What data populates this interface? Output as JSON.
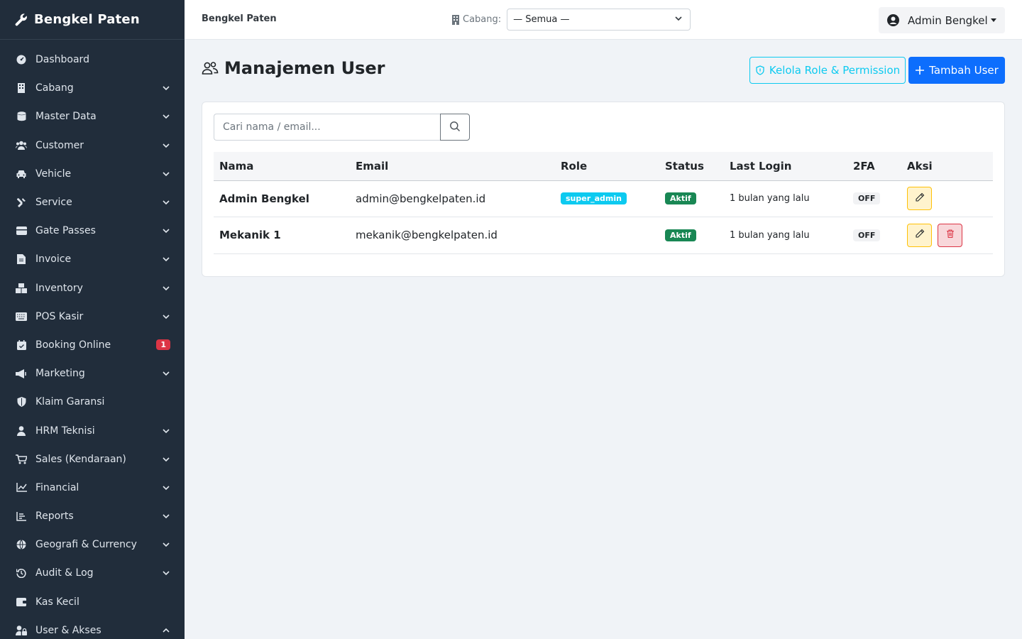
{
  "brand": {
    "name": "Bengkel Paten",
    "icon": "wrench-icon"
  },
  "sidebar": {
    "items": [
      {
        "label": "Dashboard",
        "icon": "dashboard-icon",
        "chevron": false
      },
      {
        "label": "Cabang",
        "icon": "building-icon",
        "chevron": "down"
      },
      {
        "label": "Master Data",
        "icon": "database-icon",
        "chevron": "down"
      },
      {
        "label": "Customer",
        "icon": "users-icon",
        "chevron": "down"
      },
      {
        "label": "Vehicle",
        "icon": "car-icon",
        "chevron": "down"
      },
      {
        "label": "Service",
        "icon": "tools-icon",
        "chevron": "down"
      },
      {
        "label": "Gate Passes",
        "icon": "ticket-icon",
        "chevron": "down"
      },
      {
        "label": "Invoice",
        "icon": "invoice-icon",
        "chevron": "down"
      },
      {
        "label": "Inventory",
        "icon": "boxes-icon",
        "chevron": "down"
      },
      {
        "label": "POS Kasir",
        "icon": "keyboard-icon",
        "chevron": "down"
      },
      {
        "label": "Booking Online",
        "icon": "calendar-icon",
        "chevron": false,
        "badge": "1"
      },
      {
        "label": "Marketing",
        "icon": "megaphone-icon",
        "chevron": "down"
      },
      {
        "label": "Klaim Garansi",
        "icon": "shield-icon",
        "chevron": false
      },
      {
        "label": "HRM Teknisi",
        "icon": "user-tie-icon",
        "chevron": "down"
      },
      {
        "label": "Sales (Kendaraan)",
        "icon": "cart-icon",
        "chevron": "down"
      },
      {
        "label": "Financial",
        "icon": "chart-line-icon",
        "chevron": "down"
      },
      {
        "label": "Reports",
        "icon": "bar-chart-icon",
        "chevron": "down"
      },
      {
        "label": "Geografi & Currency",
        "icon": "globe-icon",
        "chevron": "down"
      },
      {
        "label": "Audit & Log",
        "icon": "history-icon",
        "chevron": "down"
      },
      {
        "label": "Kas Kecil",
        "icon": "wallet-icon",
        "chevron": false
      },
      {
        "label": "User & Akses",
        "icon": "user-lock-icon",
        "chevron": "up"
      }
    ]
  },
  "topbar": {
    "title": "Bengkel Paten",
    "branch_label": "Cabang:",
    "branch_value": "— Semua —",
    "user_name": "Admin Bengkel"
  },
  "page": {
    "title": "Manajemen User",
    "role_button": "Kelola Role & Permission",
    "add_button": "Tambah User"
  },
  "search": {
    "placeholder": "Cari nama / email..."
  },
  "table": {
    "columns": [
      "Nama",
      "Email",
      "Role",
      "Status",
      "Last Login",
      "2FA",
      "Aksi"
    ],
    "rows": [
      {
        "name": "Admin Bengkel",
        "email": "admin@bengkelpaten.id",
        "role": "super_admin",
        "status": "Aktif",
        "last_login": "1 bulan yang lalu",
        "twofa": "OFF",
        "can_delete": false
      },
      {
        "name": "Mekanik 1",
        "email": "mekanik@bengkelpaten.id",
        "role": "",
        "status": "Aktif",
        "last_login": "1 bulan yang lalu",
        "twofa": "OFF",
        "can_delete": true
      }
    ]
  },
  "colors": {
    "sidebar": "#212d3b",
    "primary": "#0d6efd",
    "info": "#0dcaf0",
    "success": "#198754",
    "danger": "#dc3545",
    "warning": "#ffc107"
  }
}
